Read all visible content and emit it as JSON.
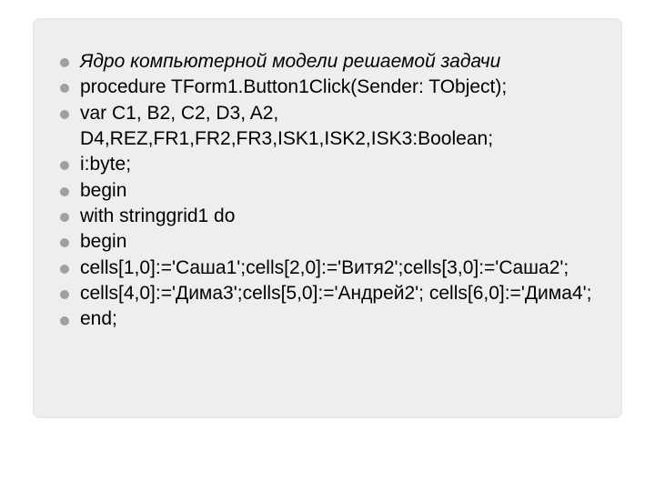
{
  "slide": {
    "lines": [
      {
        "text": "Ядро компьютерной модели решаемой задачи",
        "italic": true
      },
      {
        "text": "procedure TForm1.Button1Click(Sender: TObject);",
        "italic": false
      },
      {
        "text": "var C1, B2, C2, D3, A2, D4,REZ,FR1,FR2,FR3,ISK1,ISK2,ISK3:Boolean;",
        "italic": false
      },
      {
        "text": "    i:byte;",
        "italic": false
      },
      {
        "text": "begin",
        "italic": false
      },
      {
        "text": "with stringgrid1 do",
        "italic": false
      },
      {
        "text": "begin",
        "italic": false
      },
      {
        "text": "cells[1,0]:='Саша1';cells[2,0]:='Витя2';cells[3,0]:='Cаша2';",
        "italic": false
      },
      {
        "text": "cells[4,0]:='Дима3';cells[5,0]:='Андрей2'; cells[6,0]:='Дима4';",
        "italic": false
      },
      {
        "text": "end;",
        "italic": false
      }
    ]
  }
}
